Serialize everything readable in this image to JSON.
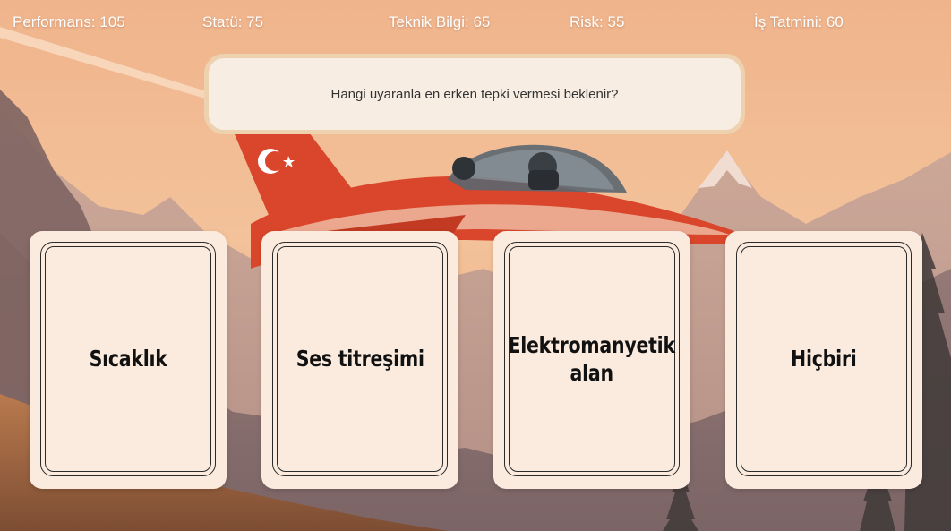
{
  "stats": {
    "performance": "Performans: 105",
    "status": "Statü: 75",
    "technical": "Teknik Bilgi: 65",
    "risk": "Risk: 55",
    "satisfaction": "İş Tatmini: 60"
  },
  "question": "Hangi uyaranla en erken tepki vermesi beklenir?",
  "answers": [
    "Sıcaklık",
    "Ses titreşimi",
    "Elektromanyetik alan",
    "Hiçbiri"
  ],
  "colors": {
    "sky_top": "#f2b890",
    "sky_bottom": "#e9a07a",
    "card": "#fbebdf",
    "jet_red": "#d9462b"
  },
  "icons": [
    "turkish-flag-emblem",
    "fighter-jet",
    "pilot-figures"
  ]
}
